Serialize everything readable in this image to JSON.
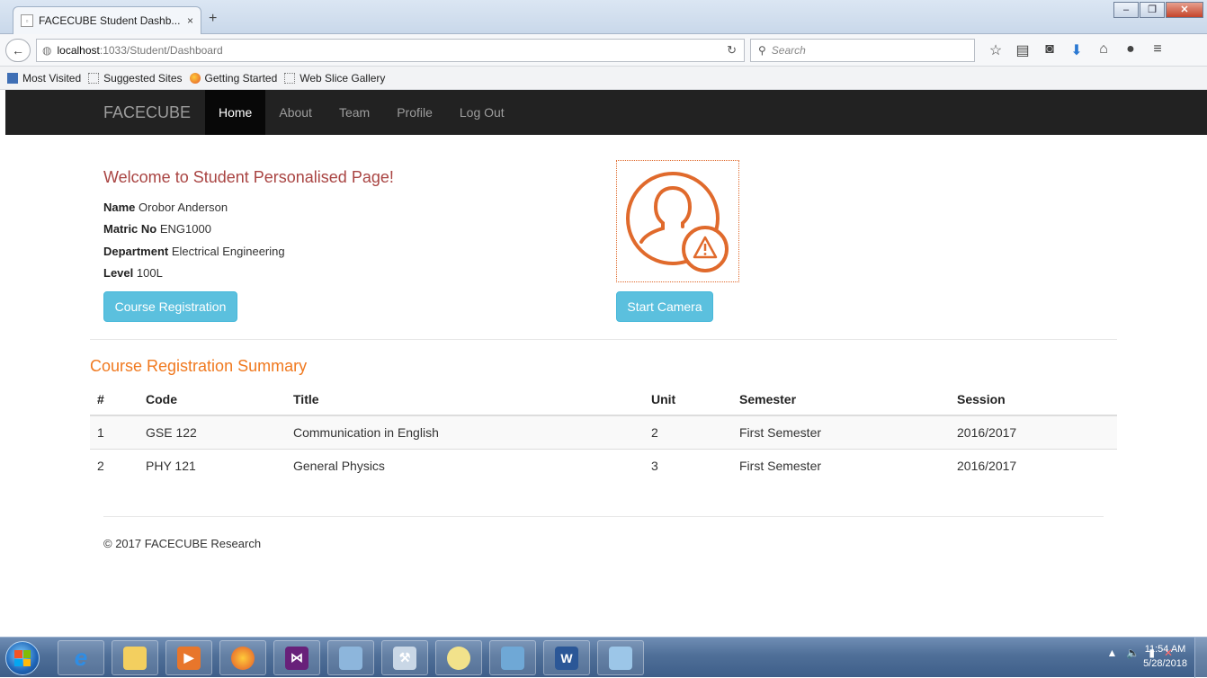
{
  "browser": {
    "tab_title": "FACECUBE Student Dashb...",
    "tab_close": "×",
    "new_tab": "+",
    "url_host": "localhost",
    "url_path": ":1033/Student/Dashboard",
    "search_placeholder": "Search",
    "bookmarks": [
      "Most Visited",
      "Suggested Sites",
      "Getting Started",
      "Web Slice Gallery"
    ]
  },
  "site": {
    "brand": "FACECUBE",
    "nav": [
      "Home",
      "About",
      "Team",
      "Profile",
      "Log Out"
    ],
    "active_nav": "Home"
  },
  "profile": {
    "welcome": "Welcome to Student Personalised Page!",
    "name_label": "Name",
    "name_value": "Orobor Anderson",
    "matric_label": "Matric No",
    "matric_value": "ENG1000",
    "department_label": "Department",
    "department_value": "Electrical Engineering",
    "level_label": "Level",
    "level_value": "100L",
    "course_registration_button": "Course Registration",
    "start_camera_button": "Start Camera"
  },
  "summary": {
    "title": "Course Registration Summary",
    "headers": [
      "#",
      "Code",
      "Title",
      "Unit",
      "Semester",
      "Session"
    ],
    "rows": [
      [
        "1",
        "GSE 122",
        "Communication in English",
        "2",
        "First Semester",
        "2016/2017"
      ],
      [
        "2",
        "PHY 121",
        "General Physics",
        "3",
        "First Semester",
        "2016/2017"
      ]
    ]
  },
  "footer": "© 2017 FACECUBE Research",
  "taskbar": {
    "time": "11:54 AM",
    "date": "5/28/2018"
  },
  "colors": {
    "accent_orange": "#e06a2c",
    "btn_info": "#5bc0de",
    "welcome_red": "#a94442",
    "navbar_bg": "#222222"
  }
}
